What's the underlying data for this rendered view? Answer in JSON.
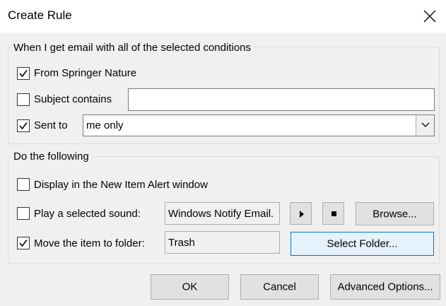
{
  "dialog": {
    "title": "Create Rule"
  },
  "conditions": {
    "group_label": "When I get email with all of the selected conditions",
    "from": {
      "label": "From Springer Nature",
      "checked": true
    },
    "subject": {
      "label": "Subject contains",
      "checked": false,
      "value": ""
    },
    "sent_to": {
      "label": "Sent to",
      "checked": true,
      "selected": "me only"
    }
  },
  "actions": {
    "group_label": "Do the following",
    "alert": {
      "label": "Display in the New Item Alert window",
      "checked": false
    },
    "sound": {
      "label": "Play a selected sound:",
      "checked": false,
      "file": "Windows Notify Email.",
      "browse_label": "Browse..."
    },
    "move": {
      "label": "Move the item to folder:",
      "checked": true,
      "folder": "Trash",
      "select_folder_label": "Select Folder..."
    }
  },
  "footer": {
    "ok_label": "OK",
    "cancel_label": "Cancel",
    "advanced_label": "Advanced Options..."
  }
}
